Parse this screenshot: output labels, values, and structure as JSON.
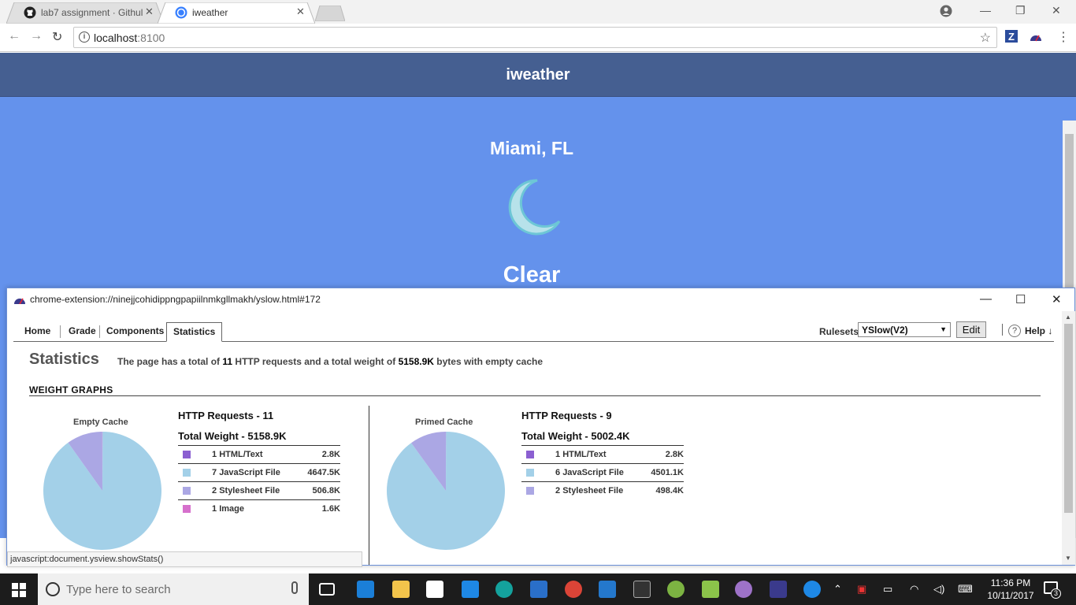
{
  "browser": {
    "tabs": [
      {
        "title": "lab7 assignment · Githul",
        "icon": "github-icon"
      },
      {
        "title": "iweather",
        "icon": "ionic-icon"
      }
    ],
    "address": {
      "host": "localhost",
      "port": ":8100"
    },
    "extensions": [
      "zotero-icon",
      "yslow-icon"
    ]
  },
  "app": {
    "title": "iweather",
    "city": "Miami, FL",
    "icon": "moon-icon",
    "condition": "Clear"
  },
  "yslow": {
    "window_title": "chrome-extension://ninejjcohidippngpapiilnmkgllmakh/yslow.html#172",
    "tabs": [
      "Home",
      "Grade",
      "Components",
      "Statistics"
    ],
    "active_tab": "Statistics",
    "rulesets_label": "Rulesets",
    "ruleset_selected": "YSlow(V2)",
    "edit_label": "Edit",
    "help_label": "Help ↓",
    "stats_title": "Statistics",
    "summary": {
      "prefix": "The page has a total of",
      "requests": "11",
      "middle": "HTTP requests and a total weight of",
      "weight": "5158.9K",
      "suffix": "bytes with empty cache"
    },
    "section_title": "WEIGHT GRAPHS",
    "empty": {
      "pie_label": "Empty Cache",
      "requests": "HTTP Requests - 11",
      "weight": "Total Weight - 5158.9K",
      "rows": [
        {
          "count": "1",
          "type": "HTML/Text",
          "size": "2.8K",
          "color": "#8b5fd1"
        },
        {
          "count": "7",
          "type": "JavaScript File",
          "size": "4647.5K",
          "color": "#a3d0e8"
        },
        {
          "count": "2",
          "type": "Stylesheet File",
          "size": "506.8K",
          "color": "#aba7e4"
        },
        {
          "count": "1",
          "type": "Image",
          "size": "1.6K",
          "color": "#d670cc"
        }
      ]
    },
    "primed": {
      "pie_label": "Primed Cache",
      "requests": "HTTP Requests - 9",
      "weight": "Total Weight - 5002.4K",
      "rows": [
        {
          "count": "1",
          "type": "HTML/Text",
          "size": "2.8K",
          "color": "#8b5fd1"
        },
        {
          "count": "6",
          "type": "JavaScript File",
          "size": "4501.1K",
          "color": "#a3d0e8"
        },
        {
          "count": "2",
          "type": "Stylesheet File",
          "size": "498.4K",
          "color": "#aba7e4"
        }
      ]
    },
    "status_text": "javascript:document.ysview.showStats()"
  },
  "taskbar": {
    "search_placeholder": "Type here to search",
    "time": "11:36 PM",
    "date": "10/11/2017",
    "notifications": "3"
  },
  "chart_data": [
    {
      "type": "pie",
      "title": "Empty Cache",
      "categories": [
        "HTML/Text",
        "JavaScript File",
        "Stylesheet File",
        "Image"
      ],
      "values": [
        2.8,
        4647.5,
        506.8,
        1.6
      ]
    },
    {
      "type": "pie",
      "title": "Primed Cache",
      "categories": [
        "HTML/Text",
        "JavaScript File",
        "Stylesheet File"
      ],
      "values": [
        2.8,
        4501.1,
        498.4
      ]
    }
  ]
}
